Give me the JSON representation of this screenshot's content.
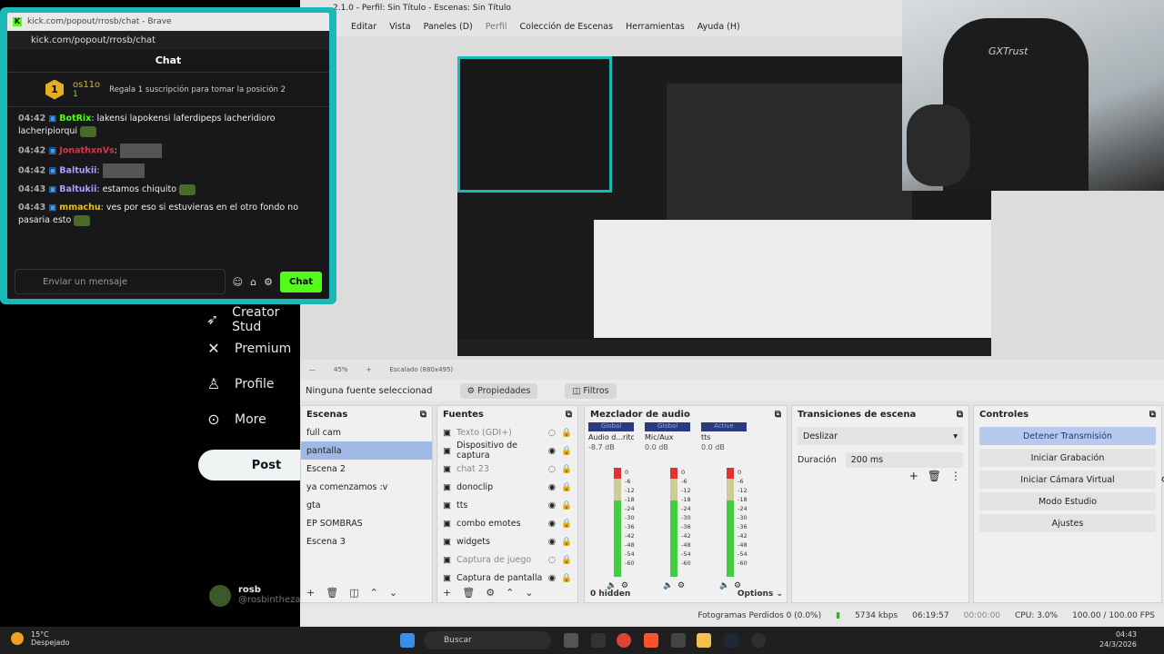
{
  "browser": {
    "title": "kick.com/popout/rrosb/chat - Brave",
    "url": "kick.com/popout/rrosb/chat"
  },
  "chat": {
    "header": "Chat",
    "pinned": {
      "rank": "1",
      "name": "os11o",
      "count": "1",
      "text": "Regala 1 suscripción para tomar la posición 2"
    },
    "messages": [
      {
        "time": "04:42",
        "user": "BotRix",
        "user_color": "#53fc18",
        "text": "lakensi lapokensi laferdipeps lacheridioro lacheripiorqui"
      },
      {
        "time": "04:42",
        "user": "JonathxnVs",
        "user_color": "#e0304a",
        "text": ""
      },
      {
        "time": "04:42",
        "user": "Baltukii",
        "user_color": "#b29bff",
        "text": ""
      },
      {
        "time": "04:43",
        "user": "Baltukii",
        "user_color": "#b29bff",
        "text": "estamos chiquito"
      },
      {
        "time": "04:43",
        "user": "mmachu",
        "user_color": "#e0c020",
        "text": "ves por eso si estuvieras en el otro fondo no pasaria esto"
      }
    ],
    "input_placeholder": "Enviar un mensaje",
    "send_label": "Chat"
  },
  "x_sidebar": {
    "items": [
      "Creator Stud",
      "Premium",
      "Profile",
      "More"
    ],
    "post_label": "Post",
    "user": {
      "name": "rosb",
      "handle": "@rosbinthezaz"
    }
  },
  "obs": {
    "title": "2.1.0 - Perfil: Sin Título - Escenas: Sin Título",
    "menu": [
      "Editar",
      "Vista",
      "Paneles (D)",
      "Perfil",
      "Colección de Escenas",
      "Herramientas",
      "Ayuda (H)"
    ],
    "zoom": "45%",
    "scaling": "Escalado (880x495)",
    "no_source": "Ninguna fuente seleccionad",
    "props_label": "Propiedades",
    "filters_label": "Filtros",
    "scenes_title": "Escenas",
    "scenes": [
      "full cam",
      "pantalla",
      "Escena 2",
      "ya comenzamos :v",
      "gta",
      "EP SOMBRAS",
      "Escena 3"
    ],
    "selected_scene": "pantalla",
    "sources_title": "Fuentes",
    "sources": [
      {
        "name": "Texto (GDI+)",
        "dim": true
      },
      {
        "name": "Dispositivo de captura",
        "dim": false
      },
      {
        "name": "chat 23",
        "dim": true
      },
      {
        "name": "donoclip",
        "dim": false
      },
      {
        "name": "tts",
        "dim": false
      },
      {
        "name": "combo emotes",
        "dim": false
      },
      {
        "name": "widgets",
        "dim": false
      },
      {
        "name": "Captura de juego",
        "dim": true
      },
      {
        "name": "Captura de pantalla",
        "dim": false
      }
    ],
    "mixer_title": "Mezclador de audio",
    "mixer": [
      {
        "head": "Global",
        "name": "Audio d...ritorio",
        "db": "-8.7 dB"
      },
      {
        "head": "Global",
        "name": "Mic/Aux",
        "db": "0.0 dB"
      },
      {
        "head": "Active",
        "name": "tts",
        "db": "0.0 dB"
      }
    ],
    "mixer_ticks": [
      "0",
      "-6",
      "-12",
      "-18",
      "-24",
      "-30",
      "-36",
      "-42",
      "-48",
      "-54",
      "-60"
    ],
    "mixer_hidden": "0 hidden",
    "options_label": "Options",
    "transitions_title": "Transiciones de escena",
    "transition": "Deslizar",
    "duration_label": "Duración",
    "duration": "200 ms",
    "controls_title": "Controles",
    "controls": [
      "Detener Transmisión",
      "Iniciar Grabación",
      "Iniciar Cámara Virtual",
      "Modo Estudio",
      "Ajustes"
    ],
    "status": {
      "dropped": "Fotogramas Perdidos 0 (0.0%)",
      "kbps": "5734 kbps",
      "stream_time": "06:19:57",
      "rec_time": "00:00:00",
      "cpu": "CPU: 3.0%",
      "fps": "100.00 / 100.00 FPS"
    }
  },
  "webcam": {
    "brand": "GXTrust"
  },
  "taskbar": {
    "weather_temp": "15°C",
    "weather_desc": "Despejado",
    "search": "Buscar",
    "time": "04:43",
    "date": "24/3/2026"
  }
}
